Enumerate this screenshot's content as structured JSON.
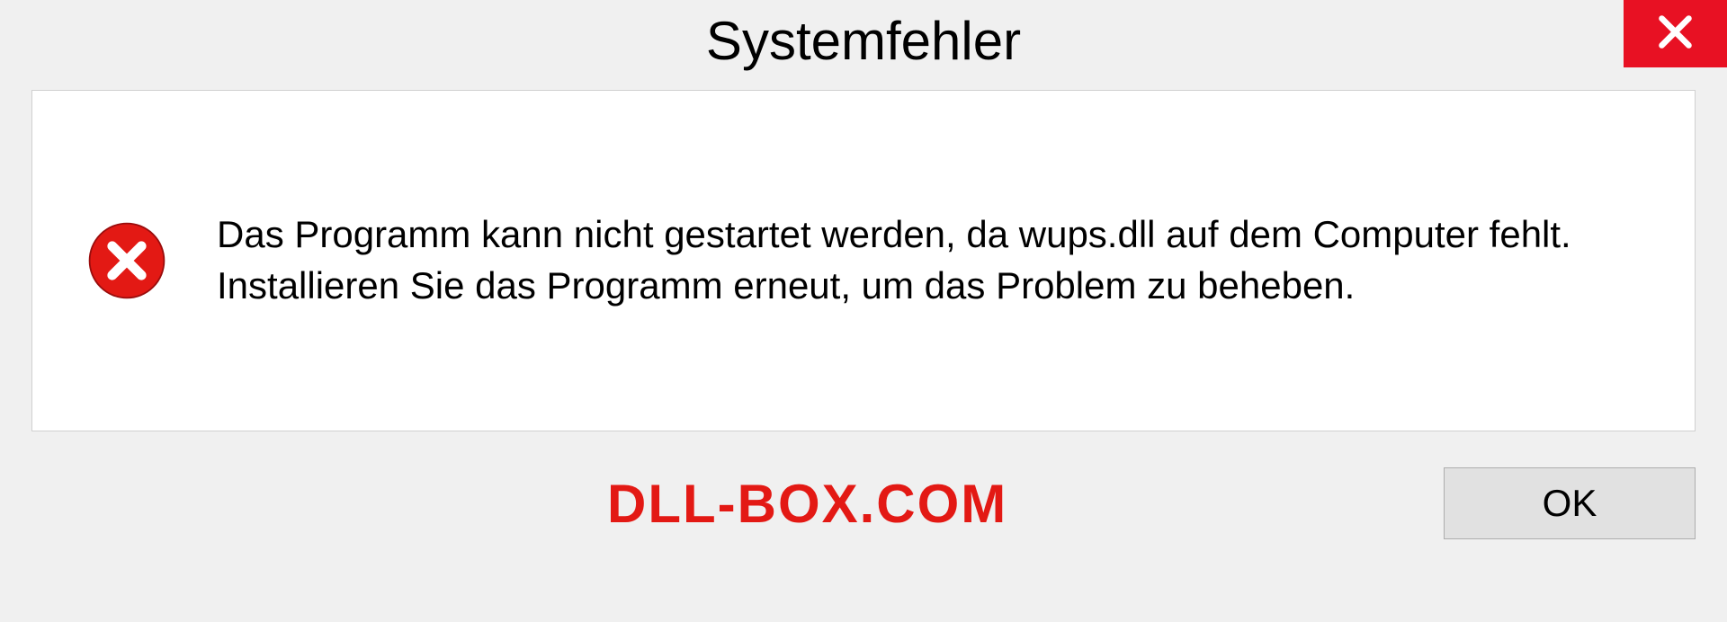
{
  "dialog": {
    "title": "Systemfehler",
    "message": "Das Programm kann nicht gestartet werden, da wups.dll auf dem Computer fehlt. Installieren Sie das Programm erneut, um das Problem zu beheben.",
    "ok_label": "OK"
  },
  "watermark": "DLL-BOX.COM"
}
